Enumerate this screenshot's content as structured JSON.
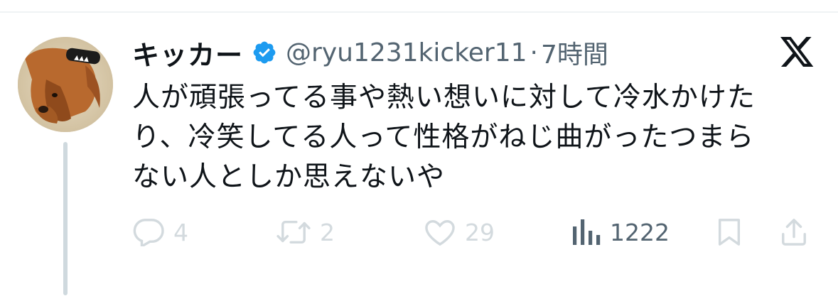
{
  "tweet": {
    "author": {
      "display_name": "キッカー",
      "verified": true,
      "handle": "@ryu1231kicker11",
      "avatar_icon": "dog-avatar"
    },
    "separator": "·",
    "time": "7時間",
    "platform_icon": "x-logo-icon",
    "text_lines": [
      "人が頑張ってる事や熱い想いに対して冷水かけた",
      "り、冷笑してる人って性格がねじ曲がったつまら",
      "ない人としか思えないや"
    ],
    "metrics": {
      "replies": "4",
      "reposts": "2",
      "likes": "29",
      "views": "1222"
    }
  },
  "colors": {
    "text": "#0f1419",
    "secondary": "#536471",
    "faded_action": "#d3dade",
    "verified_badge": "#1d9bf0",
    "thread_line": "#cfd9de"
  }
}
